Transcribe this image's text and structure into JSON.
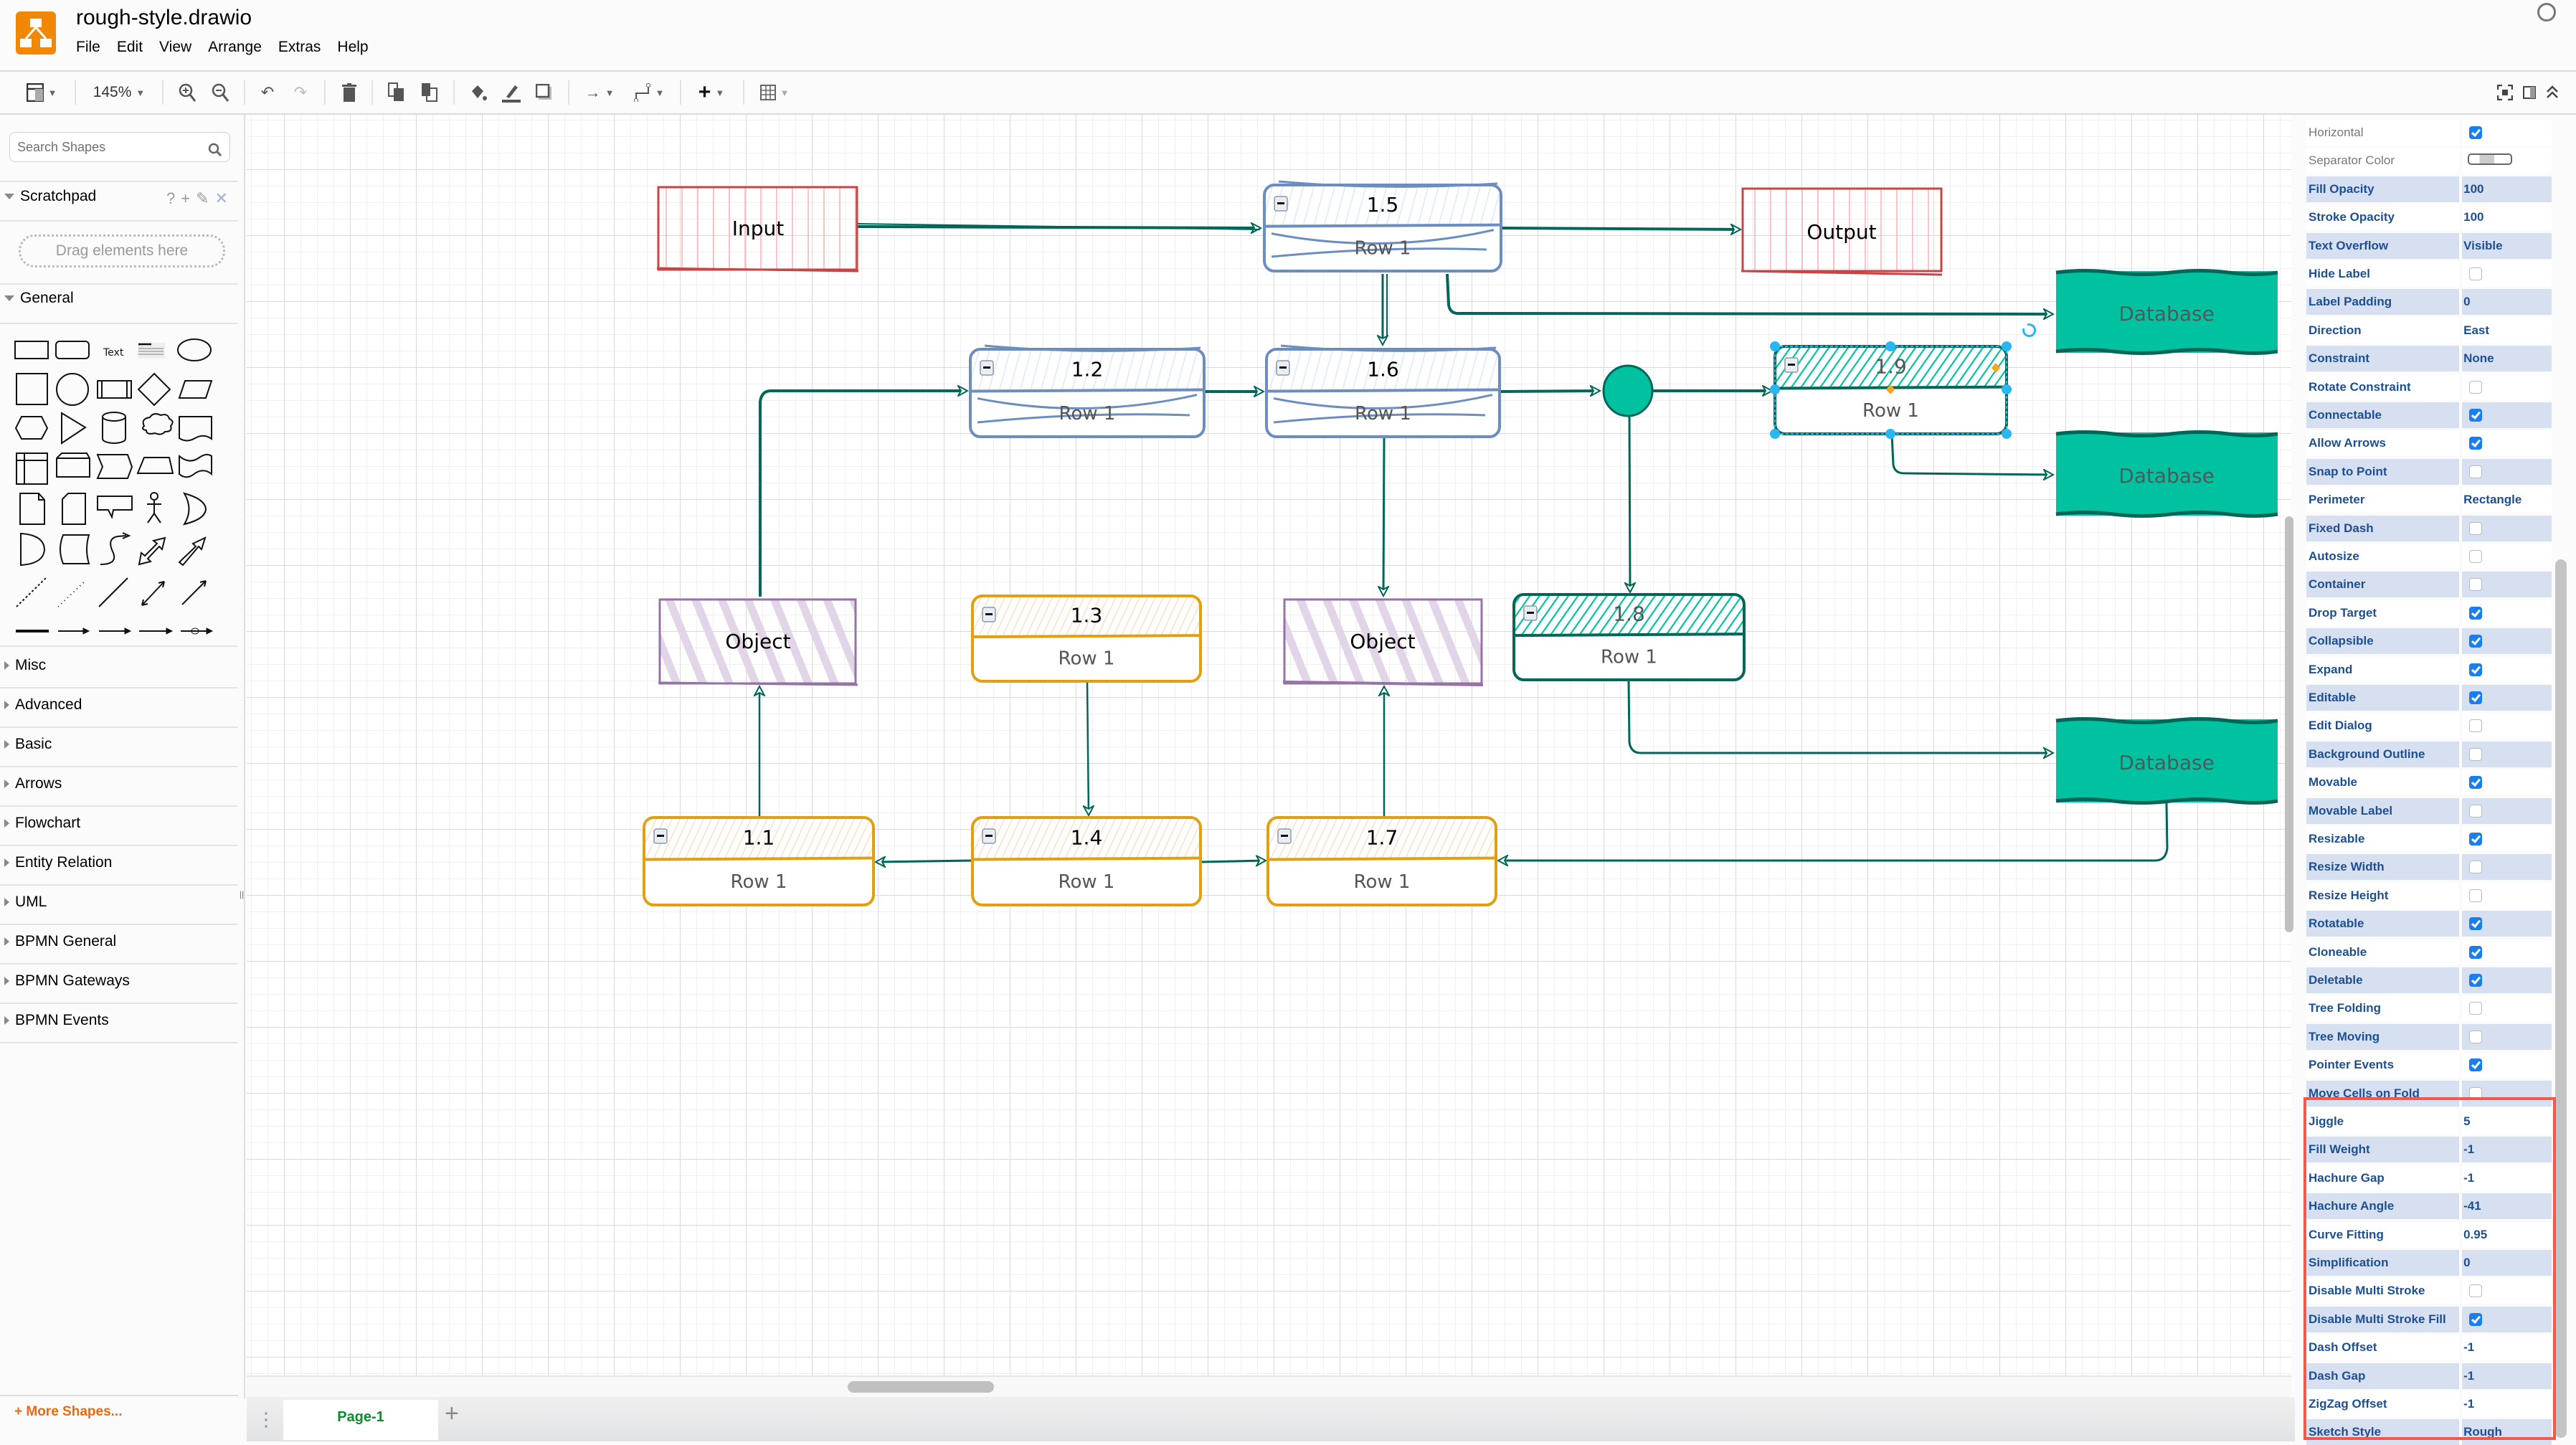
{
  "app": {
    "title": "rough-style.drawio",
    "menu": [
      "File",
      "Edit",
      "View",
      "Arrange",
      "Extras",
      "Help"
    ]
  },
  "toolbar": {
    "zoom_level": "145%",
    "icons": [
      "format-panel-icon",
      "zoom-in-icon",
      "zoom-out-icon",
      "undo-icon",
      "redo-icon",
      "delete-icon",
      "to-front-icon",
      "to-back-icon",
      "fill-color-icon",
      "line-color-icon",
      "shadow-icon",
      "connection-icon",
      "waypoints-icon",
      "insert-icon",
      "table-icon"
    ],
    "right_icons": [
      "fullscreen-icon",
      "format-toggle-icon",
      "collapse-icon"
    ]
  },
  "sidebar": {
    "search_placeholder": "Search Shapes",
    "scratchpad": {
      "label": "Scratchpad",
      "drop_hint": "Drag elements here",
      "tools": [
        "?",
        "+",
        "✎",
        "✕"
      ]
    },
    "general_label": "General",
    "shape_text_label": "Text",
    "sections": [
      "Misc",
      "Advanced",
      "Basic",
      "Arrows",
      "Flowchart",
      "Entity Relation",
      "UML",
      "BPMN General",
      "BPMN Gateways",
      "BPMN Events"
    ],
    "more_shapes": "+ More Shapes..."
  },
  "pages": {
    "tabs": [
      "Page-1"
    ]
  },
  "diagram": {
    "colors": {
      "edge": "#006658",
      "teal": "#00c2a0",
      "teal_dark": "#006658",
      "red": "#c94545",
      "red_fill": "#f7c2c2",
      "blue": "#6c8ebf",
      "blue_fill": "#dae8fc",
      "orange": "#e0a010",
      "orange_fill": "#fde3c8",
      "purple": "#9673a6",
      "purple_fill": "#e1d5e7"
    },
    "nodes": {
      "input": "Input",
      "output": "Output",
      "db1": "Database",
      "db2": "Database",
      "db3": "Database",
      "obj1": "Object",
      "obj2": "Object",
      "t15": {
        "title": "1.5",
        "row": "Row 1"
      },
      "t12": {
        "title": "1.2",
        "row": "Row 1"
      },
      "t16": {
        "title": "1.6",
        "row": "Row 1"
      },
      "t19": {
        "title": "1.9",
        "row": "Row 1"
      },
      "t13": {
        "title": "1.3",
        "row": "Row 1"
      },
      "t18": {
        "title": "1.8",
        "row": "Row 1"
      },
      "t11": {
        "title": "1.1",
        "row": "Row 1"
      },
      "t14": {
        "title": "1.4",
        "row": "Row 1"
      },
      "t17": {
        "title": "1.7",
        "row": "Row 1"
      }
    }
  },
  "properties": [
    {
      "key": "Horizontal",
      "type": "check",
      "value": true,
      "dim": true
    },
    {
      "key": "Separator Color",
      "type": "color",
      "value": "",
      "dim": true
    },
    {
      "key": "Fill Opacity",
      "type": "text",
      "value": "100"
    },
    {
      "key": "Stroke Opacity",
      "type": "text",
      "value": "100"
    },
    {
      "key": "Text Overflow",
      "type": "text",
      "value": "Visible"
    },
    {
      "key": "Hide Label",
      "type": "check",
      "value": false
    },
    {
      "key": "Label Padding",
      "type": "text",
      "value": "0"
    },
    {
      "key": "Direction",
      "type": "text",
      "value": "East"
    },
    {
      "key": "Constraint",
      "type": "text",
      "value": "None"
    },
    {
      "key": "Rotate Constraint",
      "type": "check",
      "value": false
    },
    {
      "key": "Connectable",
      "type": "check",
      "value": true
    },
    {
      "key": "Allow Arrows",
      "type": "check",
      "value": true
    },
    {
      "key": "Snap to Point",
      "type": "check",
      "value": false
    },
    {
      "key": "Perimeter",
      "type": "text",
      "value": "Rectangle"
    },
    {
      "key": "Fixed Dash",
      "type": "check",
      "value": false
    },
    {
      "key": "Autosize",
      "type": "check",
      "value": false
    },
    {
      "key": "Container",
      "type": "check",
      "value": false
    },
    {
      "key": "Drop Target",
      "type": "check",
      "value": true
    },
    {
      "key": "Collapsible",
      "type": "check",
      "value": true
    },
    {
      "key": "Expand",
      "type": "check",
      "value": true
    },
    {
      "key": "Editable",
      "type": "check",
      "value": true
    },
    {
      "key": "Edit Dialog",
      "type": "check",
      "value": false
    },
    {
      "key": "Background Outline",
      "type": "check",
      "value": false
    },
    {
      "key": "Movable",
      "type": "check",
      "value": true
    },
    {
      "key": "Movable Label",
      "type": "check",
      "value": false
    },
    {
      "key": "Resizable",
      "type": "check",
      "value": true
    },
    {
      "key": "Resize Width",
      "type": "check",
      "value": false
    },
    {
      "key": "Resize Height",
      "type": "check",
      "value": false
    },
    {
      "key": "Rotatable",
      "type": "check",
      "value": true
    },
    {
      "key": "Cloneable",
      "type": "check",
      "value": true
    },
    {
      "key": "Deletable",
      "type": "check",
      "value": true
    },
    {
      "key": "Tree Folding",
      "type": "check",
      "value": false
    },
    {
      "key": "Tree Moving",
      "type": "check",
      "value": false
    },
    {
      "key": "Pointer Events",
      "type": "check",
      "value": true
    },
    {
      "key": "Move Cells on Fold",
      "type": "check",
      "value": false
    },
    {
      "key": "Jiggle",
      "type": "text",
      "value": "5"
    },
    {
      "key": "Fill Weight",
      "type": "text",
      "value": "-1"
    },
    {
      "key": "Hachure Gap",
      "type": "text",
      "value": "-1"
    },
    {
      "key": "Hachure Angle",
      "type": "text",
      "value": "-41"
    },
    {
      "key": "Curve Fitting",
      "type": "text",
      "value": "0.95"
    },
    {
      "key": "Simplification",
      "type": "text",
      "value": "0"
    },
    {
      "key": "Disable Multi Stroke",
      "type": "check",
      "value": false
    },
    {
      "key": "Disable Multi Stroke Fill",
      "type": "check",
      "value": true
    },
    {
      "key": "Dash Offset",
      "type": "text",
      "value": "-1"
    },
    {
      "key": "Dash Gap",
      "type": "text",
      "value": "-1"
    },
    {
      "key": "ZigZag Offset",
      "type": "text",
      "value": "-1"
    },
    {
      "key": "Sketch Style",
      "type": "text",
      "value": "Rough"
    }
  ],
  "highlighted_group": "rough-sketch-properties"
}
